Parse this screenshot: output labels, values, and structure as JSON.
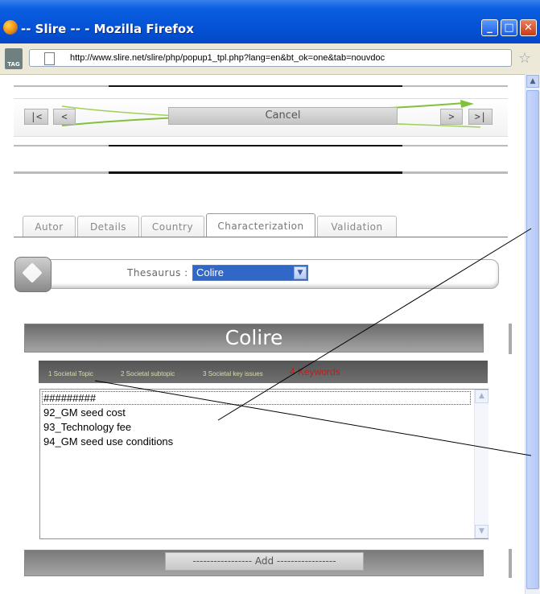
{
  "window": {
    "title": "-- Slire -- - Mozilla Firefox"
  },
  "addressbar": {
    "url": "http://www.slire.net/slire/php/popup1_tpl.php?lang=en&bt_ok=one&tab=nouvdoc",
    "tag_label": "TAG"
  },
  "nav": {
    "first": "|<",
    "prev": "<",
    "cancel": "Cancel",
    "next": ">",
    "last": ">|"
  },
  "tabs": [
    {
      "label": "Autor"
    },
    {
      "label": "Details"
    },
    {
      "label": "Country"
    },
    {
      "label": "Characterization",
      "active": true
    },
    {
      "label": "Validation"
    }
  ],
  "thesaurus": {
    "label": "Thesaurus :",
    "selected": "Colire"
  },
  "panel": {
    "title": "Colire"
  },
  "breadcrumb": {
    "step1": "1 Societal Topic",
    "step2": "2 Societal subtopic",
    "step3": "3 Societal key issues",
    "step4": "4 Keywords"
  },
  "list": {
    "items": [
      "#########",
      "92_GM seed cost",
      "93_Technology fee",
      "94_GM seed use conditions"
    ]
  },
  "add": {
    "label": "----------------- Add -----------------"
  },
  "colors": {
    "titlebar": "#0554d8",
    "select_bg": "#3168c8",
    "keywords_red": "#c41b1b"
  }
}
